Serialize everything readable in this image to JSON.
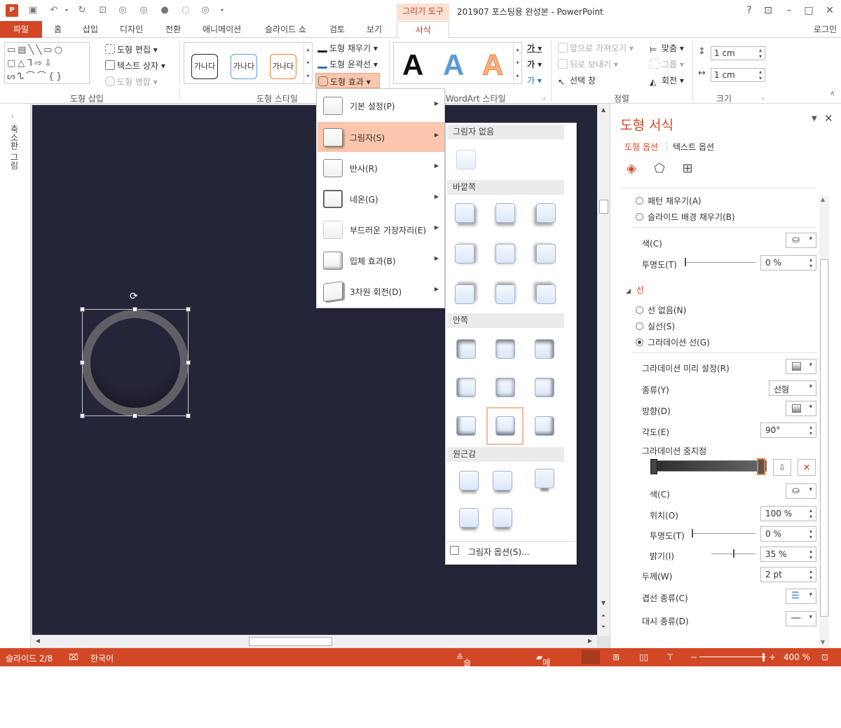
{
  "app": {
    "title": "201907 포스팅용 완성본 - PowerPoint",
    "context_group": "그리기 도구",
    "login": "로그인",
    "accent": "#d24726"
  },
  "tabs": [
    "파일",
    "홈",
    "삽입",
    "디자인",
    "전환",
    "애니메이션",
    "슬라이드 쇼",
    "검토",
    "보기",
    "서식"
  ],
  "ribbon": {
    "insert_shapes": {
      "label": "도형 삽입",
      "edit_shape": "도형 편집",
      "text_box": "텍스트 상자",
      "merge_shapes": "도형 병합"
    },
    "shape_styles": {
      "label": "도형 스타일",
      "swatch_text": "가나다",
      "fill": "도형 채우기",
      "outline": "도형 윤곽선",
      "effects": "도형 효과"
    },
    "wordart": {
      "label": "WordArt 스타일",
      "sample": "A"
    },
    "arrange": {
      "label": "정렬",
      "bring_forward": "앞으로 가져오기",
      "send_backward": "뒤로 보내기",
      "selection_pane": "선택 창",
      "align": "맞춤",
      "group": "그룹",
      "rotate": "회전"
    },
    "size": {
      "label": "크기",
      "height": "1 cm",
      "width": "1 cm"
    }
  },
  "left_pane": {
    "label": "축소판 그림"
  },
  "effects_menu": {
    "items": [
      "기본 설정(P)",
      "그림자(S)",
      "반사(R)",
      "네온(G)",
      "부드러운 가장자리(E)",
      "입체 효과(B)",
      "3차원 회전(D)"
    ],
    "active_index": 1
  },
  "shadow_gallery": {
    "sections": [
      "그림자 없음",
      "바깥쪽",
      "안쪽",
      "원근감"
    ],
    "options_label": "그림자 옵션(S)..."
  },
  "format_pane": {
    "title": "도형 서식",
    "tab_shape": "도형 옵션",
    "tab_text": "텍스트 옵션",
    "pattern_fill": "패턴 채우기(A)",
    "slide_bg_fill": "슬라이드 배경 채우기(B)",
    "fill_color": "색(C)",
    "fill_transparency_label": "투명도(T)",
    "fill_transparency": "0 %",
    "line_section": "선",
    "no_line": "선 없음(N)",
    "solid_line": "실선(S)",
    "gradient_line": "그라데이션 선(G)",
    "gradient_presets": "그라데이션 미리 설정(R)",
    "type_label": "종류(Y)",
    "type_value": "선형",
    "direction_label": "방향(D)",
    "angle_label": "각도(E)",
    "angle_value": "90°",
    "stops_label": "그라데이션 중지점",
    "stop_color": "색(C)",
    "position_label": "위치(O)",
    "position_value": "100 %",
    "stop_transparency_label": "투명도(T)",
    "stop_transparency_value": "0 %",
    "brightness_label": "밝기(I)",
    "brightness_value": "35 %",
    "width_label": "두께(W)",
    "width_value": "2 pt",
    "compound_label": "겹선 종류(C)",
    "dash_label": "대시 종류(D)"
  },
  "status": {
    "slide": "슬라이드 2/8",
    "language": "한국어",
    "notes": "슬라이드 노트",
    "comments": "메모",
    "zoom": "400 %"
  }
}
